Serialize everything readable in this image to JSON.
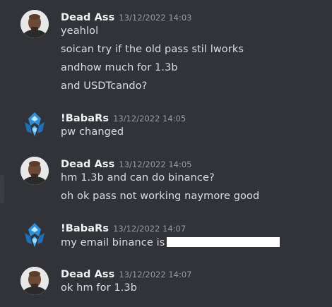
{
  "messages": [
    {
      "author": "Dead Ass",
      "timestamp": "13/12/2022 14:03",
      "avatar_icon": "bald-man-avatar",
      "lines": [
        "yeahlol",
        "soican try if the old pass stil lworks",
        "andhow much for 1.3b",
        "and USDTcando?"
      ]
    },
    {
      "author": "!BabaRs",
      "timestamp": "13/12/2022 14:05",
      "avatar_icon": "blue-crystal-emblem-avatar",
      "lines": [
        "pw changed"
      ]
    },
    {
      "author": "Dead Ass",
      "timestamp": "13/12/2022 14:05",
      "avatar_icon": "bald-man-avatar",
      "lines": [
        "hm 1.3b and can do binance?",
        "oh ok pass not working naymore good"
      ]
    },
    {
      "author": "!BabaRs",
      "timestamp": "13/12/2022 14:07",
      "avatar_icon": "blue-crystal-emblem-avatar",
      "lines": [
        "my email binance is"
      ]
    },
    {
      "author": "Dead Ass",
      "timestamp": "13/12/2022 14:07",
      "avatar_icon": "bald-man-avatar",
      "lines": [
        "ok hm for 1.3b"
      ]
    }
  ],
  "colors": {
    "background": "#313338",
    "author": "#f2f3f5",
    "text": "#dbdee1",
    "timestamp": "#949ba4",
    "redaction": "#ffffff"
  }
}
